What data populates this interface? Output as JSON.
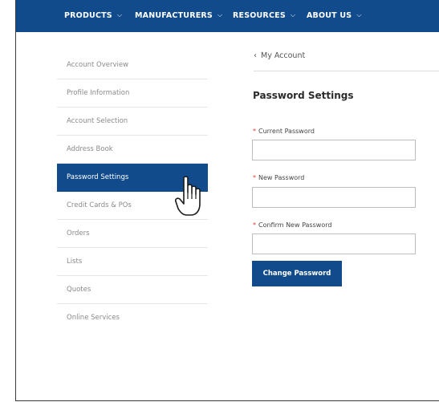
{
  "nav": {
    "items": [
      {
        "label": "PRODUCTS"
      },
      {
        "label": "MANUFACTURERS"
      },
      {
        "label": "RESOURCES"
      },
      {
        "label": "ABOUT US"
      }
    ],
    "chevron_icon": "chevron-down-icon"
  },
  "sidebar": {
    "items": [
      {
        "label": "Account Overview",
        "active": false
      },
      {
        "label": "Profile Information",
        "active": false
      },
      {
        "label": "Account Selection",
        "active": false
      },
      {
        "label": "Address Book",
        "active": false
      },
      {
        "label": "Password Settings",
        "active": true
      },
      {
        "label": "Credit Cards & POs",
        "active": false
      },
      {
        "label": "Orders",
        "active": false
      },
      {
        "label": "Lists",
        "active": false
      },
      {
        "label": "Quotes",
        "active": false
      },
      {
        "label": "Online Services",
        "active": false
      }
    ]
  },
  "breadcrumb": {
    "label": "My Account",
    "icon": "chevron-left-icon"
  },
  "form": {
    "title": "Password Settings",
    "required_marker": "*",
    "fields": [
      {
        "label": "Current Password",
        "value": ""
      },
      {
        "label": "New Password",
        "value": ""
      },
      {
        "label": "Confirm New Password",
        "value": ""
      }
    ],
    "submit_label": "Change Password"
  },
  "cursor": {
    "icon": "hand-pointer-icon"
  },
  "colors": {
    "brand": "#114b8b",
    "required": "#d33a2c",
    "sidebar_text": "#8a8a8a"
  }
}
